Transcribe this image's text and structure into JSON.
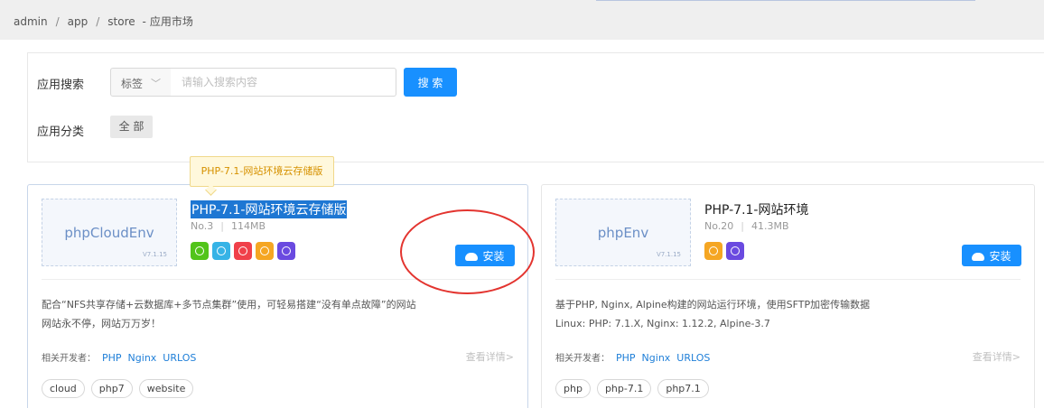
{
  "breadcrumb": {
    "items": [
      "admin",
      "app",
      "store"
    ],
    "separator": "/",
    "dash": "-",
    "page": "应用市场"
  },
  "search": {
    "label": "应用搜索",
    "select_value": "标签",
    "placeholder": "请输入搜索内容",
    "button": "搜 索"
  },
  "category": {
    "label": "应用分类",
    "all": "全 部"
  },
  "tooltip": "PHP-7.1-网站环境云存储版",
  "cards": [
    {
      "thumb_name": "phpCloudEnv",
      "thumb_version": "V7.1.15",
      "title": "PHP-7.1-网站环境云存储版",
      "number": "No.3",
      "size": "114MB",
      "icons": [
        {
          "name": "transfer-icon",
          "color": "#52c41a"
        },
        {
          "name": "cluster-icon",
          "color": "#36b3e6"
        },
        {
          "name": "cloud-db-icon",
          "color": "#f0404a"
        },
        {
          "name": "image-icon",
          "color": "#f5a623"
        },
        {
          "name": "power-icon",
          "color": "#6a4ae0"
        }
      ],
      "install": "安装",
      "desc_line1": "配合“NFS共享存储+云数据库+多节点集群”使用，可轻易搭建“没有单点故障”的网站",
      "desc_line2": "网站永不停，网站万万岁！",
      "dev_label": "相关开发者：",
      "developers": [
        "PHP",
        "Nginx",
        "URLOS"
      ],
      "detail": "查看详情>",
      "tags": [
        "cloud",
        "php7",
        "website"
      ]
    },
    {
      "thumb_name": "phpEnv",
      "thumb_version": "V7.1.15",
      "title": "PHP-7.1-网站环境",
      "number": "No.20",
      "size": "41.3MB",
      "icons": [
        {
          "name": "image-icon",
          "color": "#f5a623"
        },
        {
          "name": "power-icon",
          "color": "#6a4ae0"
        }
      ],
      "install": "安装",
      "desc_line1": "基于PHP, Nginx, Alpine构建的网站运行环境，使用SFTP加密传输数据",
      "desc_line2": "Linux: PHP: 7.1.X, Nginx: 1.12.2, Alpine-3.7",
      "dev_label": "相关开发者：",
      "developers": [
        "PHP",
        "Nginx",
        "URLOS"
      ],
      "detail": "查看详情>",
      "tags": [
        "php",
        "php-7.1",
        "php7.1"
      ]
    }
  ],
  "colors": {
    "primary": "#1890ff",
    "link": "#1f7fd8",
    "annotation": "#e3342f",
    "tooltip_text": "#d69100"
  }
}
